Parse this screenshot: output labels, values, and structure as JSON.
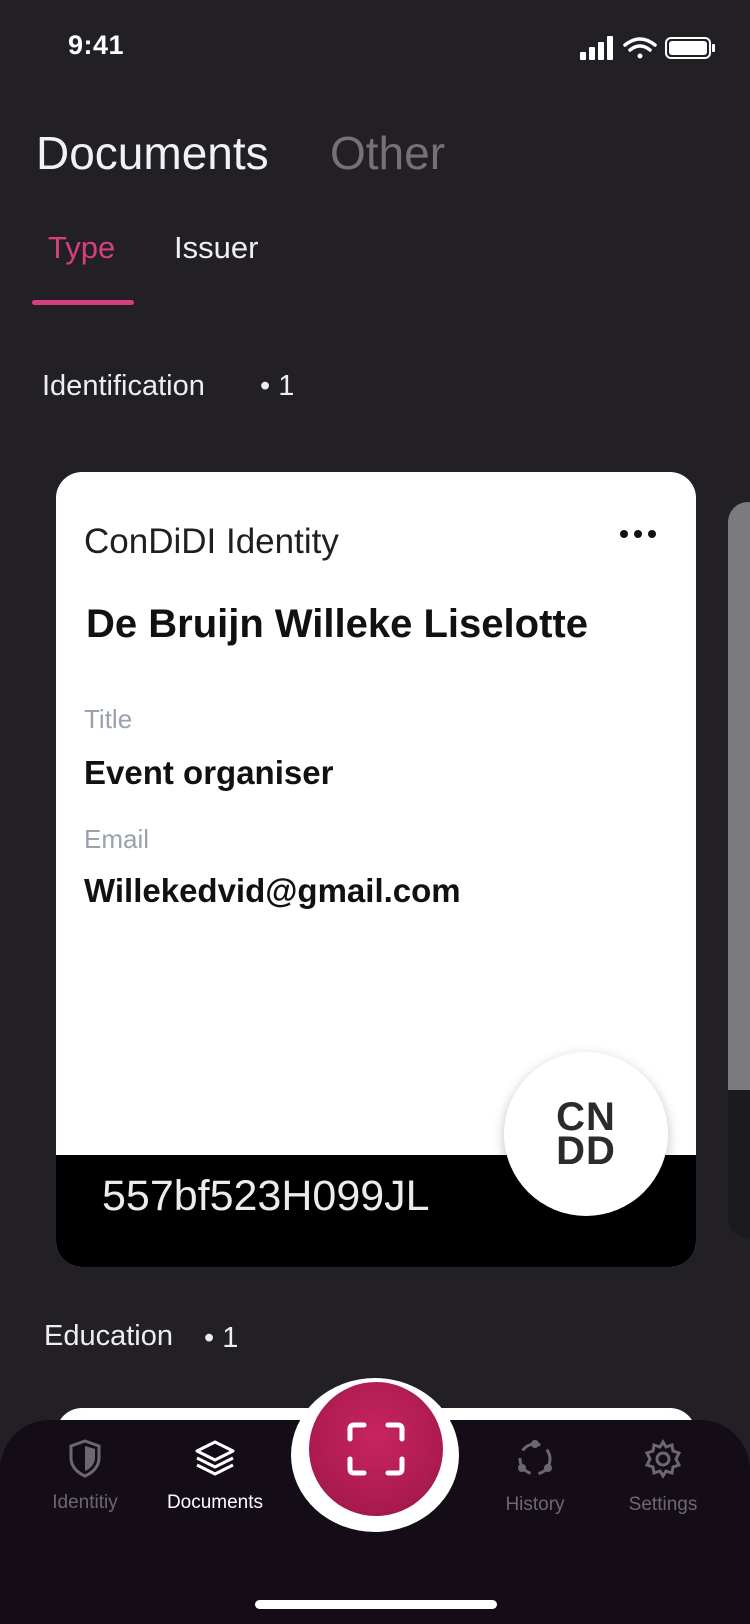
{
  "status_bar": {
    "time": "9:41"
  },
  "header": {
    "tabs": [
      {
        "label": "Documents",
        "active": true
      },
      {
        "label": "Other",
        "active": false
      }
    ],
    "subtabs": [
      {
        "label": "Type",
        "active": true
      },
      {
        "label": "Issuer",
        "active": false
      }
    ],
    "accent_color": "#d4407e"
  },
  "sections": [
    {
      "label": "Identification",
      "count": "• 1"
    },
    {
      "label": "Education",
      "count": "• 1"
    }
  ],
  "card": {
    "title": "ConDiDI Identity",
    "name": "De Bruijn Willeke Liselotte",
    "fields": [
      {
        "label": "Title",
        "value": "Event organiser"
      },
      {
        "label": "Email",
        "value": "Willekedvid@gmail.com"
      }
    ],
    "id": "557bf523H099JL",
    "logo_text": "CN\nDD",
    "menu_icon": "more-dots-icon"
  },
  "bottom_nav": {
    "items": [
      {
        "label": "Identitiy",
        "icon": "shield-icon",
        "active": false
      },
      {
        "label": "Documents",
        "icon": "layers-icon",
        "active": true
      },
      {
        "label": "History",
        "icon": "history-icon",
        "active": false
      },
      {
        "label": "Settings",
        "icon": "gear-icon",
        "active": false
      }
    ],
    "center_button_icon": "scan-icon",
    "center_color": "#b41e55"
  }
}
